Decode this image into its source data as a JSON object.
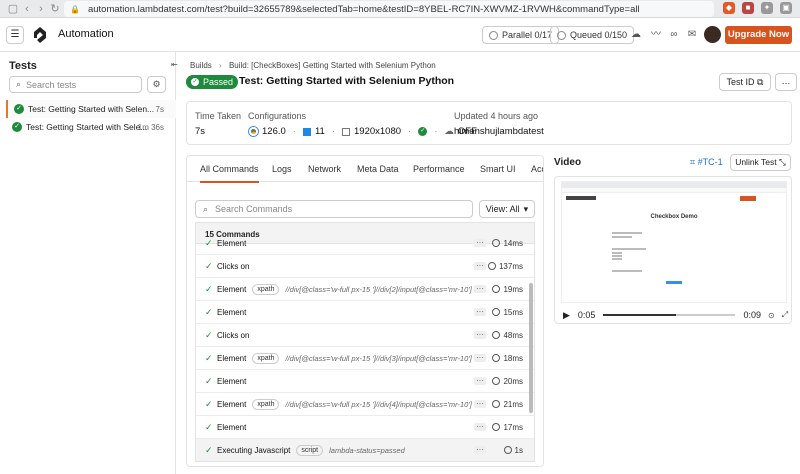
{
  "browser": {
    "url": "automation.lambdatest.com/test?build=32655789&selectedTab=home&testID=8YBEL-RC7IN-XWVMZ-1RVWH&commandType=all"
  },
  "header": {
    "title": "Automation",
    "parallel": "Parallel 0/17",
    "queued": "Queued 0/150",
    "upgrade": "Upgrade Now"
  },
  "left": {
    "title": "Tests",
    "search_placeholder": "Search tests",
    "tests": [
      {
        "name": "Test: Getting Started with Selen...",
        "duration": "7s"
      },
      {
        "name": "Test: Getting Started with Sele...",
        "duration": "1m 36s"
      }
    ]
  },
  "breadcrumb": {
    "builds": "Builds",
    "build": "Build: [CheckBoxes] Getting Started with Selenium Python"
  },
  "test": {
    "status": "Passed",
    "title": "Test: Getting Started with Selenium Python",
    "testid_label": "Test ID"
  },
  "info": {
    "time_taken_label": "Time Taken",
    "time_taken": "7s",
    "configurations_label": "Configurations",
    "browser_version": "126.0",
    "os_version": "11",
    "resolution": "1920x1080",
    "tunnel": "OFF",
    "updated_label": "Updated 4 hours ago",
    "user": "himanshujlambdatest"
  },
  "tabs": [
    "All Commands",
    "Logs",
    "Network",
    "Meta Data",
    "Performance",
    "Smart UI",
    "Acc"
  ],
  "commands": {
    "search_placeholder": "Search Commands",
    "view_label": "View: All",
    "count_label": "15 Commands",
    "rows": [
      {
        "name": "Element",
        "tag": "",
        "selector": "",
        "time": "14ms"
      },
      {
        "name": "Clicks on",
        "tag": "",
        "selector": "",
        "time": "137ms"
      },
      {
        "name": "Element",
        "tag": "xpath",
        "selector": "//div[@class='w-full px-15 ']//div[2]/input[@class='mr-10']",
        "time": "19ms"
      },
      {
        "name": "Element",
        "tag": "",
        "selector": "",
        "time": "15ms"
      },
      {
        "name": "Clicks on",
        "tag": "",
        "selector": "",
        "time": "48ms"
      },
      {
        "name": "Element",
        "tag": "xpath",
        "selector": "//div[@class='w-full px-15 ']//div[3]/input[@class='mr-10']",
        "time": "18ms"
      },
      {
        "name": "Element",
        "tag": "",
        "selector": "",
        "time": "20ms"
      },
      {
        "name": "Element",
        "tag": "xpath",
        "selector": "//div[@class='w-full px-15 ']//div[4]/input[@class='mr-10']",
        "time": "21ms"
      },
      {
        "name": "Element",
        "tag": "",
        "selector": "",
        "time": "17ms"
      },
      {
        "name": "Executing Javascript",
        "tag": "script",
        "selector": "lambda-status=passed",
        "time": "1s"
      }
    ]
  },
  "video": {
    "title": "Video",
    "tc_tag": "#TC-1",
    "unlink": "Unlink Test",
    "page_title": "Checkbox Demo",
    "current_time": "0:05",
    "total_time": "0:09",
    "progress": 0.55
  }
}
